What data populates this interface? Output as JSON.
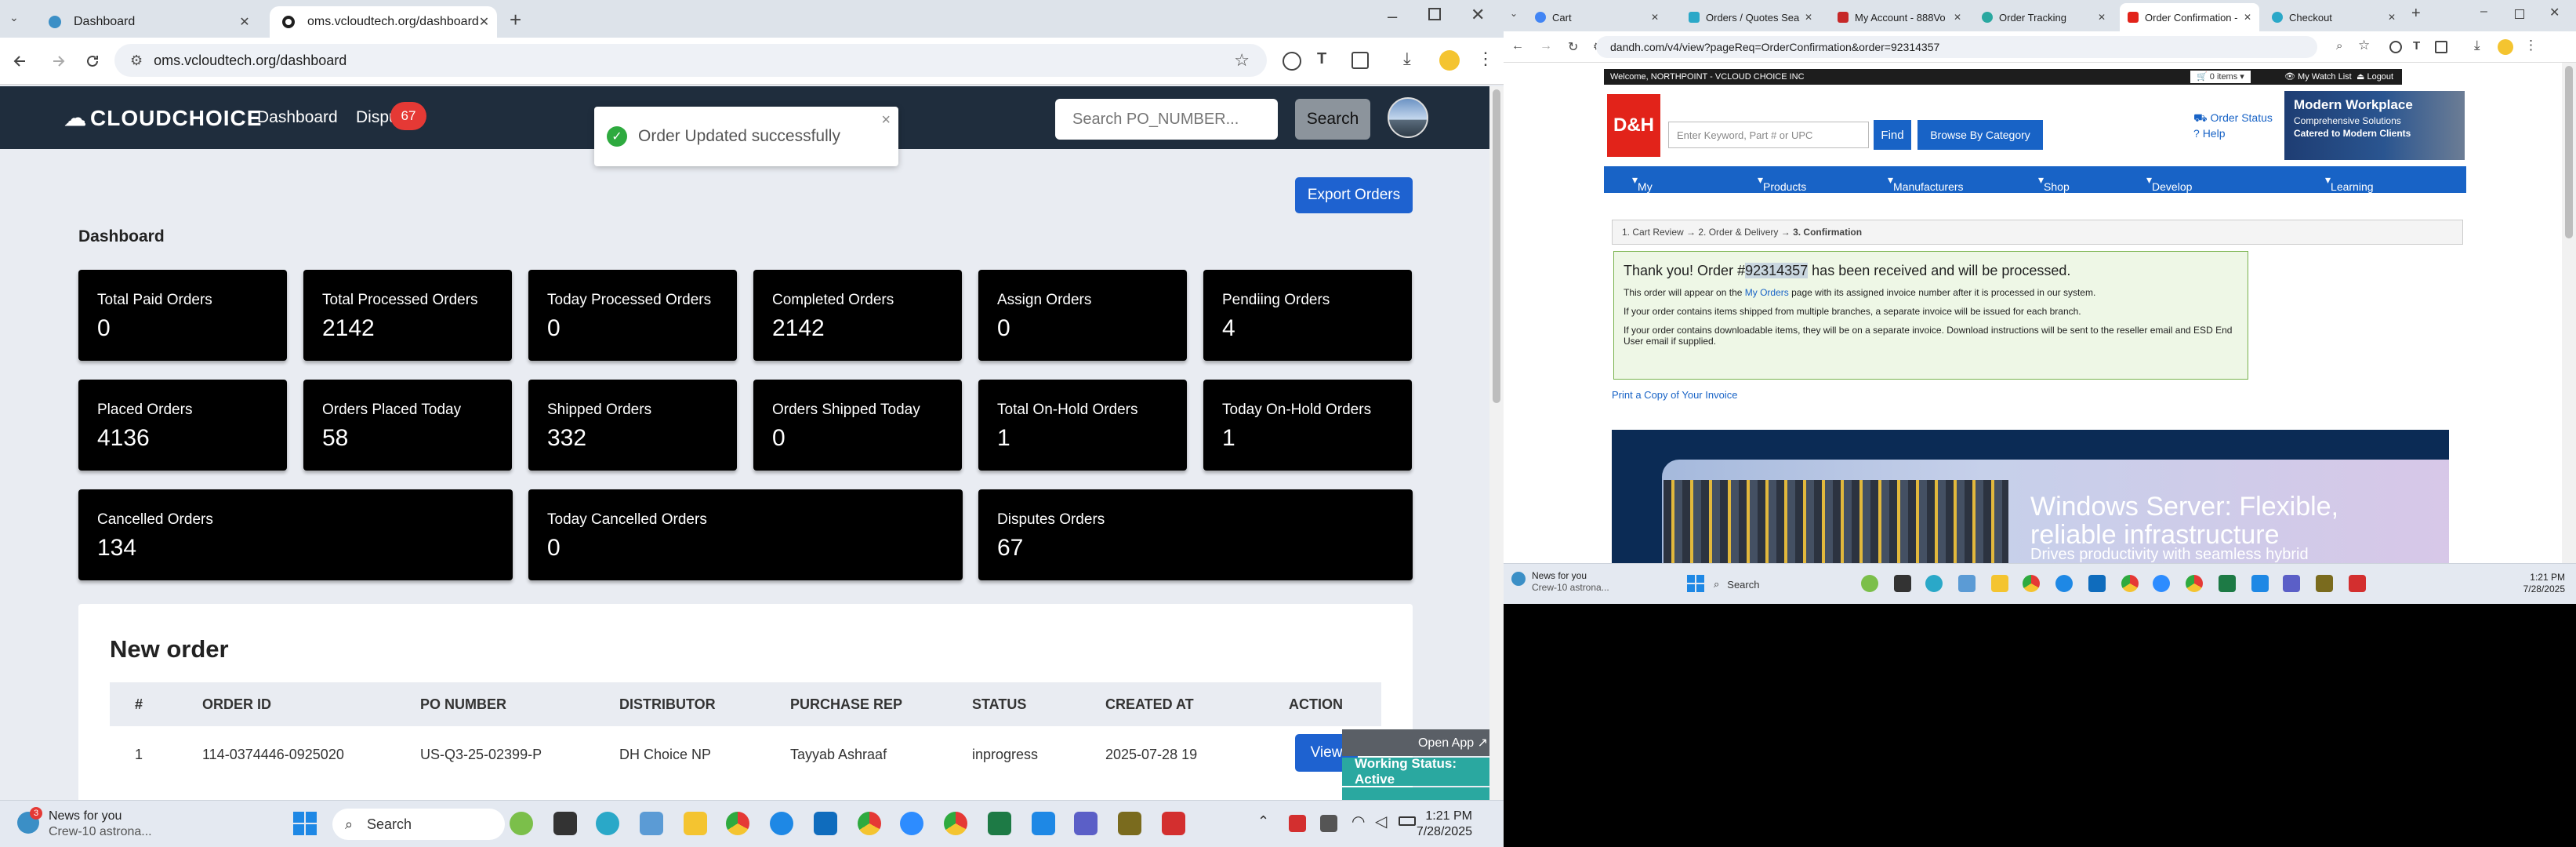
{
  "left_browser": {
    "tabs": [
      {
        "label": "Dashboard"
      },
      {
        "label": "oms.vcloudtech.org/dashboard"
      }
    ],
    "url": "oms.vcloudtech.org/dashboard"
  },
  "app": {
    "brand": "CLOUDCHOICE",
    "nav": {
      "dashboard": "Dashboard",
      "disputes": "Dispu",
      "disputes_badge": "67"
    },
    "search_placeholder": "Search PO_NUMBER...",
    "search_button": "Search",
    "toast": "Order Updated successfully",
    "export_button": "Export Orders",
    "page_title": "Dashboard",
    "stats": [
      {
        "label": "Total Paid Orders",
        "value": "0"
      },
      {
        "label": "Total Processed Orders",
        "value": "2142"
      },
      {
        "label": "Today Processed Orders",
        "value": "0"
      },
      {
        "label": "Completed Orders",
        "value": "2142"
      },
      {
        "label": "Assign Orders",
        "value": "0"
      },
      {
        "label": "Pendiing Orders",
        "value": "4"
      },
      {
        "label": "Placed Orders",
        "value": "4136"
      },
      {
        "label": "Orders Placed Today",
        "value": "58"
      },
      {
        "label": "Shipped Orders",
        "value": "332"
      },
      {
        "label": "Orders Shipped Today",
        "value": "0"
      },
      {
        "label": "Total On-Hold Orders",
        "value": "1"
      },
      {
        "label": "Today On-Hold Orders",
        "value": "1"
      },
      {
        "label": "Cancelled Orders",
        "value": "134"
      },
      {
        "label": "Today Cancelled Orders",
        "value": "0"
      },
      {
        "label": "Disputes Orders",
        "value": "67"
      }
    ],
    "new_order": {
      "title": "New order",
      "columns": [
        "#",
        "ORDER ID",
        "PO NUMBER",
        "DISTRIBUTOR",
        "PURCHASE REP",
        "STATUS",
        "CREATED AT",
        "ACTION"
      ],
      "rows": [
        {
          "num": "1",
          "order_id": "114-0374446-0925020",
          "po_number": "US-Q3-25-02399-P",
          "distributor": "DH Choice NP",
          "rep": "Tayyab Ashraaf",
          "status": "inprogress",
          "created": "2025-07-28 19",
          "action": "View"
        }
      ]
    },
    "widget": {
      "open_app": "Open App ↗",
      "working_status": "Working Status: Active"
    }
  },
  "left_taskbar": {
    "news_title": "News for you",
    "news_sub": "Crew-10 astrona...",
    "news_badge": "3",
    "search": "Search",
    "time": "1:21 PM",
    "date": "7/28/2025"
  },
  "right_browser": {
    "tabs": [
      {
        "label": "Cart"
      },
      {
        "label": "Orders / Quotes Sea"
      },
      {
        "label": "My Account - 888Vo"
      },
      {
        "label": "Order Tracking"
      },
      {
        "label": "Order Confirmation -"
      },
      {
        "label": "Checkout"
      }
    ],
    "url": "dandh.com/v4/view?pageReq=OrderConfirmation&order=92314357"
  },
  "dh": {
    "welcome": "Welcome, NORTHPOINT - VCLOUD CHOICE INC",
    "cart": "0 items",
    "watchlist": "My Watch List",
    "logout": "Logout",
    "logo": "D&H",
    "search_placeholder": "Enter Keyword, Part # or UPC",
    "find": "Find",
    "browse": "Browse By Category",
    "order_status": "Order Status",
    "help": "Help",
    "promo_title": "Modern Workplace",
    "promo_line1": "Comprehensive Solutions",
    "promo_line2": "Catered to Modern Clients",
    "menu": [
      "My D&H",
      "Products",
      "Manufacturers",
      "Shop By...",
      "Develop Your Business",
      "Learning & Training"
    ],
    "breadcrumb": {
      "step1": "1. Cart Review",
      "step2": "2. Order & Delivery",
      "step3": "3. Confirmation"
    },
    "confirm_pre": "Thank you! Order #",
    "confirm_order": "92314357",
    "confirm_post": " has been received and will be processed.",
    "p1_pre": "This order will appear on the ",
    "p1_link": "My Orders",
    "p1_post": " page with its assigned invoice number after it is processed in our system.",
    "p2": "If your order contains items shipped from multiple branches, a separate invoice will be issued for each branch.",
    "p3": "If your order contains downloadable items, they will be on a separate invoice. Download instructions will be sent to the reseller email and ESD End User email if supplied.",
    "print": "Print a Copy of Your Invoice",
    "banner_title": "Windows Server: Flexible, reliable infrastructure",
    "banner_sub": "Drives productivity with seamless hybrid"
  },
  "right_taskbar": {
    "news_title": "News for you",
    "news_sub": "Crew-10 astrona...",
    "search": "Search",
    "time": "1:21 PM",
    "date": "7/28/2025"
  },
  "colors": {
    "app_nav": "#1f2d3d",
    "card": "#000000",
    "primary_button": "#1e62d0",
    "badge": "#e53935",
    "dh_red": "#e2231a",
    "dh_blue": "#1863c6",
    "working": "#2aa8a0"
  }
}
